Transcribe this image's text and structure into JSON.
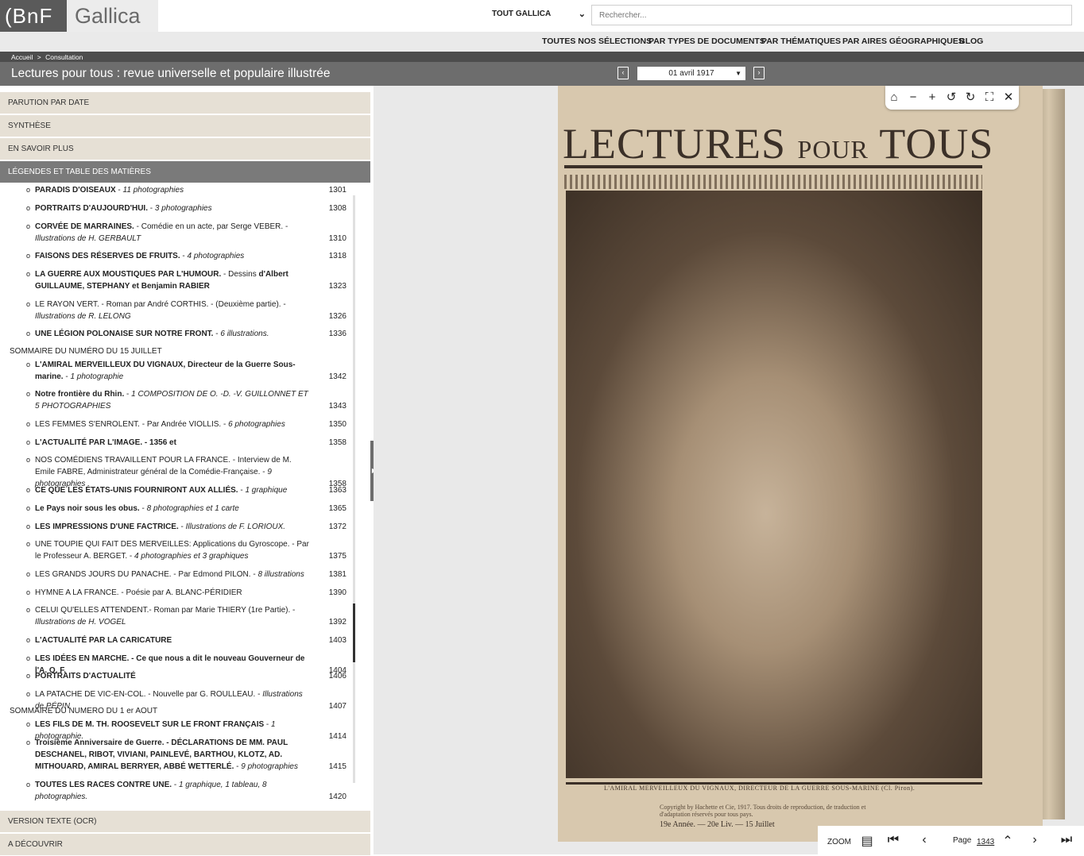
{
  "header": {
    "logo_bnf": "(BnF",
    "logo_gallica": "Gallica",
    "scope": "TOUT GALLICA",
    "search_placeholder": "Rechercher..."
  },
  "nav": [
    "TOUTES NOS SÉLECTIONS",
    "PAR TYPES DE DOCUMENTS",
    "PAR THÉMATIQUES",
    "PAR AIRES GÉOGRAPHIQUES",
    "BLOG"
  ],
  "breadcrumb": {
    "home": "Accueil",
    "sep": ">",
    "current": "Consultation"
  },
  "doc": {
    "title": "Lectures pour tous : revue universelle et populaire illustrée",
    "date": "01 avril 1917"
  },
  "sidebar": {
    "sections_top": [
      "PARUTION PAR DATE",
      "SYNTHÈSE",
      "EN SAVOIR PLUS",
      "LÉGENDES ET TABLE DES MATIÈRES"
    ],
    "sections_bottom": [
      "VERSION TEXTE (OCR)",
      "A DÉCOUVRIR"
    ],
    "toc": [
      {
        "b": "PARADIS D'OISEAUX",
        "t": " - ",
        "i": "11 photographies",
        "pg": "1301"
      },
      {
        "b": "PORTRAITS D'AUJOURD'HUI.",
        "t": " - ",
        "i": "3 photographies",
        "pg": "1308"
      },
      {
        "b": "CORVÉE DE MARRAINES.",
        "t": " - Comédie en un acte, par Serge VEBER. - ",
        "i": "Illustrations de H. GERBAULT",
        "pg": "1310"
      },
      {
        "b": "FAISONS DES RÉSERVES DE FRUITS.",
        "t": " - ",
        "i": "4 photographies",
        "pg": "1318"
      },
      {
        "b": "LA GUERRE AUX MOUSTIQUES PAR L'HUMOUR.",
        "t": " - Dessins ",
        "b2": "d'Albert GUILLAUME, STEPHANY et Benjamin RABIER",
        "pg": "1323"
      },
      {
        "b": "",
        "t": "LE RAYON VERT. - Roman par André CORTHIS. - (Deuxième partie). - ",
        "i": "Illustrations de R. LELONG",
        "pg": "1326"
      },
      {
        "b": "UNE LÉGION POLONAISE SUR NOTRE FRONT.",
        "t": " - ",
        "i": "6 illustrations.",
        "pg": "1336"
      },
      {
        "head": "SOMMAIRE DU NUMÉRO DU 15 JUILLET"
      },
      {
        "b": "L'AMIRAL MERVEILLEUX DU VIGNAUX, Directeur de la Guerre Sous-marine.",
        "t": " - ",
        "i": "1 photographie",
        "pg": "1342"
      },
      {
        "b": "Notre frontière du Rhin.",
        "t": " - ",
        "i": "1 COMPOSITION DE O. -D. -V. GUILLONNET ET 5 PHOTOGRAPHIES",
        "pg": "1343"
      },
      {
        "b": "",
        "t": "LES FEMMES S'ENROLENT. - Par Andrée VIOLLIS. - ",
        "i": "6 photographies",
        "pg": "1350"
      },
      {
        "b": "L'ACTUALITÉ PAR L'IMAGE. - 1356 et",
        "t": "",
        "pg": "1358"
      },
      {
        "b": "",
        "t": "NOS COMÉDIENS TRAVAILLENT POUR LA FRANCE. - Interview de M. Emile FABRE, Administrateur général de la Comédie-Française. - ",
        "i": "9 photographies",
        "pg": "1358"
      },
      {
        "b": "CE QUE LES ÉTATS-UNIS FOURNIRONT AUX ALLIÉS.",
        "t": " - ",
        "i": "1 graphique",
        "pg": "1363"
      },
      {
        "b": "Le Pays noir sous les obus.",
        "t": " - ",
        "i": "8 photographies et 1 carte",
        "pg": "1365"
      },
      {
        "b": "LES IMPRESSIONS D'UNE FACTRICE.",
        "t": " - ",
        "i": "Illustrations de F. LORIOUX.",
        "pg": "1372"
      },
      {
        "b": "",
        "t": "UNE TOUPIE QUI FAIT DES MERVEILLES: Applications du Gyroscope. - Par le Professeur A. BERGET. - ",
        "i": "4 photographies et 3 graphiques",
        "pg": "1375"
      },
      {
        "b": "",
        "t": "LES GRANDS JOURS DU PANACHE. - Par Edmond PILON. - ",
        "i": "8 illustrations",
        "pg": "1381"
      },
      {
        "b": "",
        "t": "HYMNE A LA FRANCE. - Poésie par A. BLANC-PÉRIDIER",
        "pg": "1390"
      },
      {
        "b": "",
        "t": "CELUI QU'ELLES ATTENDENT.- Roman par Marie THIERY (1re Partie). - ",
        "i": "Illustrations de H. VOGEL",
        "pg": "1392"
      },
      {
        "b": "L'ACTUALITÉ PAR LA CARICATURE",
        "t": "",
        "pg": "1403"
      },
      {
        "b": "LES IDÉES EN MARCHE. - Ce que nous a dit le nouveau Gouverneur de l'A. O. F.",
        "t": "",
        "pg": "1404"
      },
      {
        "b": "PORTRAITS D'ACTUALITÉ",
        "t": "",
        "pg": "1406"
      },
      {
        "b": "",
        "t": "LA PATACHE DE VIC-EN-COL. - Nouvelle par G. ROULLEAU. - ",
        "i": "Illustrations de PÉPIN",
        "pg": "1407"
      },
      {
        "head": "SOMMAIRE DU NUMERO DU 1 er AOUT"
      },
      {
        "b": "LES FILS DE M. TH. ROOSEVELT SUR LE FRONT FRANÇAIS",
        "t": " - ",
        "i": "1 photographie.",
        "pg": "1414"
      },
      {
        "b": "Troisième Anniversaire de Guerre. - DÉCLARATIONS DE MM. PAUL DESCHANEL, RIBOT, VIVIANI, PAINLEVÉ, BARTHOU, KLOTZ, AD. MITHOUARD, AMIRAL BERRYER, ABBÉ WETTERLÉ.",
        "t": " - ",
        "i": "9 photographies",
        "pg": "1415"
      },
      {
        "b": "TOUTES LES RACES CONTRE UNE.",
        "t": " - ",
        "i": "1 graphique, 1 tableau, 8 photographies.",
        "pg": "1420"
      }
    ]
  },
  "page_image": {
    "masthead": "LECTURES",
    "masthead_small": "POUR",
    "masthead_end": "TOUS",
    "caption": "L'AMIRAL MERVEILLEUX DU VIGNAUX, DIRECTEUR DE LA GUERRE SOUS-MARINE (Cl. Piron).",
    "copyright": "Copyright by Hachette et Cie, 1917. Tous droits de reproduction, de traduction et d'adaptation réservés pour tous pays.",
    "issue": "19e Année. — 20e Liv. — 15 Juillet"
  },
  "viewer": {
    "zoom_label": "ZOOM",
    "page_label": "Page",
    "page_number": "1343",
    "tools": [
      "home-icon",
      "zoom-out-icon",
      "zoom-in-icon",
      "rotate-left-icon",
      "rotate-right-icon",
      "fullscreen-icon",
      "close-icon"
    ]
  }
}
